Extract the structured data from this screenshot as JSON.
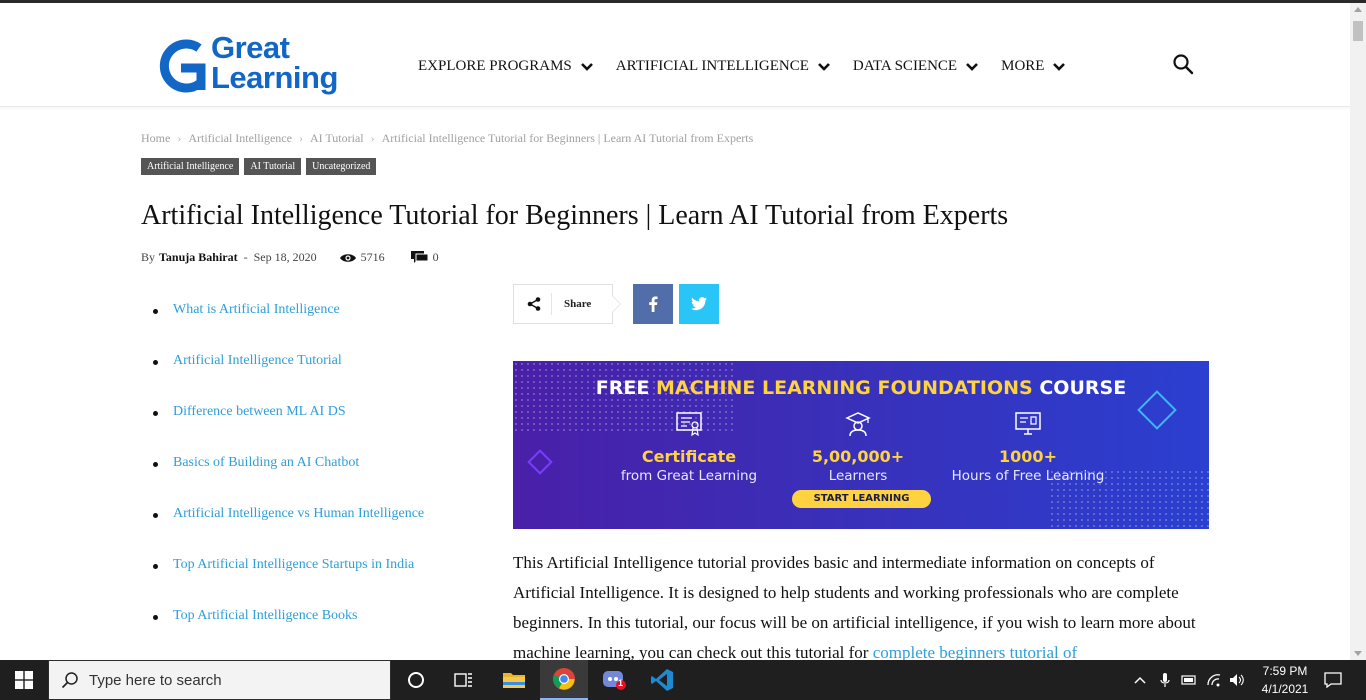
{
  "header": {
    "logo_line1": "Great",
    "logo_line2": "Learning",
    "brand_color": "#1266c5",
    "nav": [
      {
        "label": "EXPLORE PROGRAMS"
      },
      {
        "label": "ARTIFICIAL INTELLIGENCE"
      },
      {
        "label": "DATA SCIENCE"
      },
      {
        "label": "MORE"
      }
    ],
    "search_icon": "search-icon"
  },
  "breadcrumb": [
    "Home",
    "Artificial Intelligence",
    "AI Tutorial",
    "Artificial Intelligence Tutorial for Beginners | Learn AI Tutorial from Experts"
  ],
  "tags": [
    "Artificial Intelligence",
    "AI Tutorial",
    "Uncategorized"
  ],
  "article": {
    "title": "Artificial Intelligence Tutorial for Beginners | Learn AI Tutorial from Experts",
    "by_label": "By",
    "author": "Tanuja Bahirat",
    "date": "Sep 18, 2020",
    "views": "5716",
    "comments": "0"
  },
  "toc": [
    "What is Artificial Intelligence",
    "Artificial Intelligence Tutorial",
    "Difference between ML AI DS",
    "Basics of Building an AI Chatbot",
    "Artificial Intelligence vs Human Intelligence",
    "Top Artificial Intelligence Startups in India",
    "Top Artificial Intelligence Books"
  ],
  "share": {
    "label": "Share",
    "facebook_color": "#516eab",
    "twitter_color": "#29c5f6"
  },
  "banner": {
    "heading_prefix": "FREE ",
    "heading_highlight": "MACHINE LEARNING FOUNDATIONS",
    "heading_suffix": " COURSE",
    "stats": [
      {
        "big": "Certificate",
        "small": "from Great Learning",
        "icon": "certificate-icon"
      },
      {
        "big": "5,00,000+",
        "small": "Learners",
        "icon": "graduate-icon"
      },
      {
        "big": "1000+",
        "small": "Hours of Free Learning",
        "icon": "monitor-icon"
      }
    ],
    "cta": "START LEARNING"
  },
  "body": {
    "text": "This Artificial Intelligence tutorial provides basic and intermediate information on concepts of Artificial Intelligence. It is designed to help students and working professionals who are complete beginners. In this tutorial, our focus will be on artificial intelligence, if you wish to learn more about machine learning, you can check out this tutorial for ",
    "link": "complete beginners tutorial of"
  },
  "taskbar": {
    "search_placeholder": "Type here to search",
    "time": "7:59 PM",
    "date": "4/1/2021",
    "badge": "1"
  }
}
